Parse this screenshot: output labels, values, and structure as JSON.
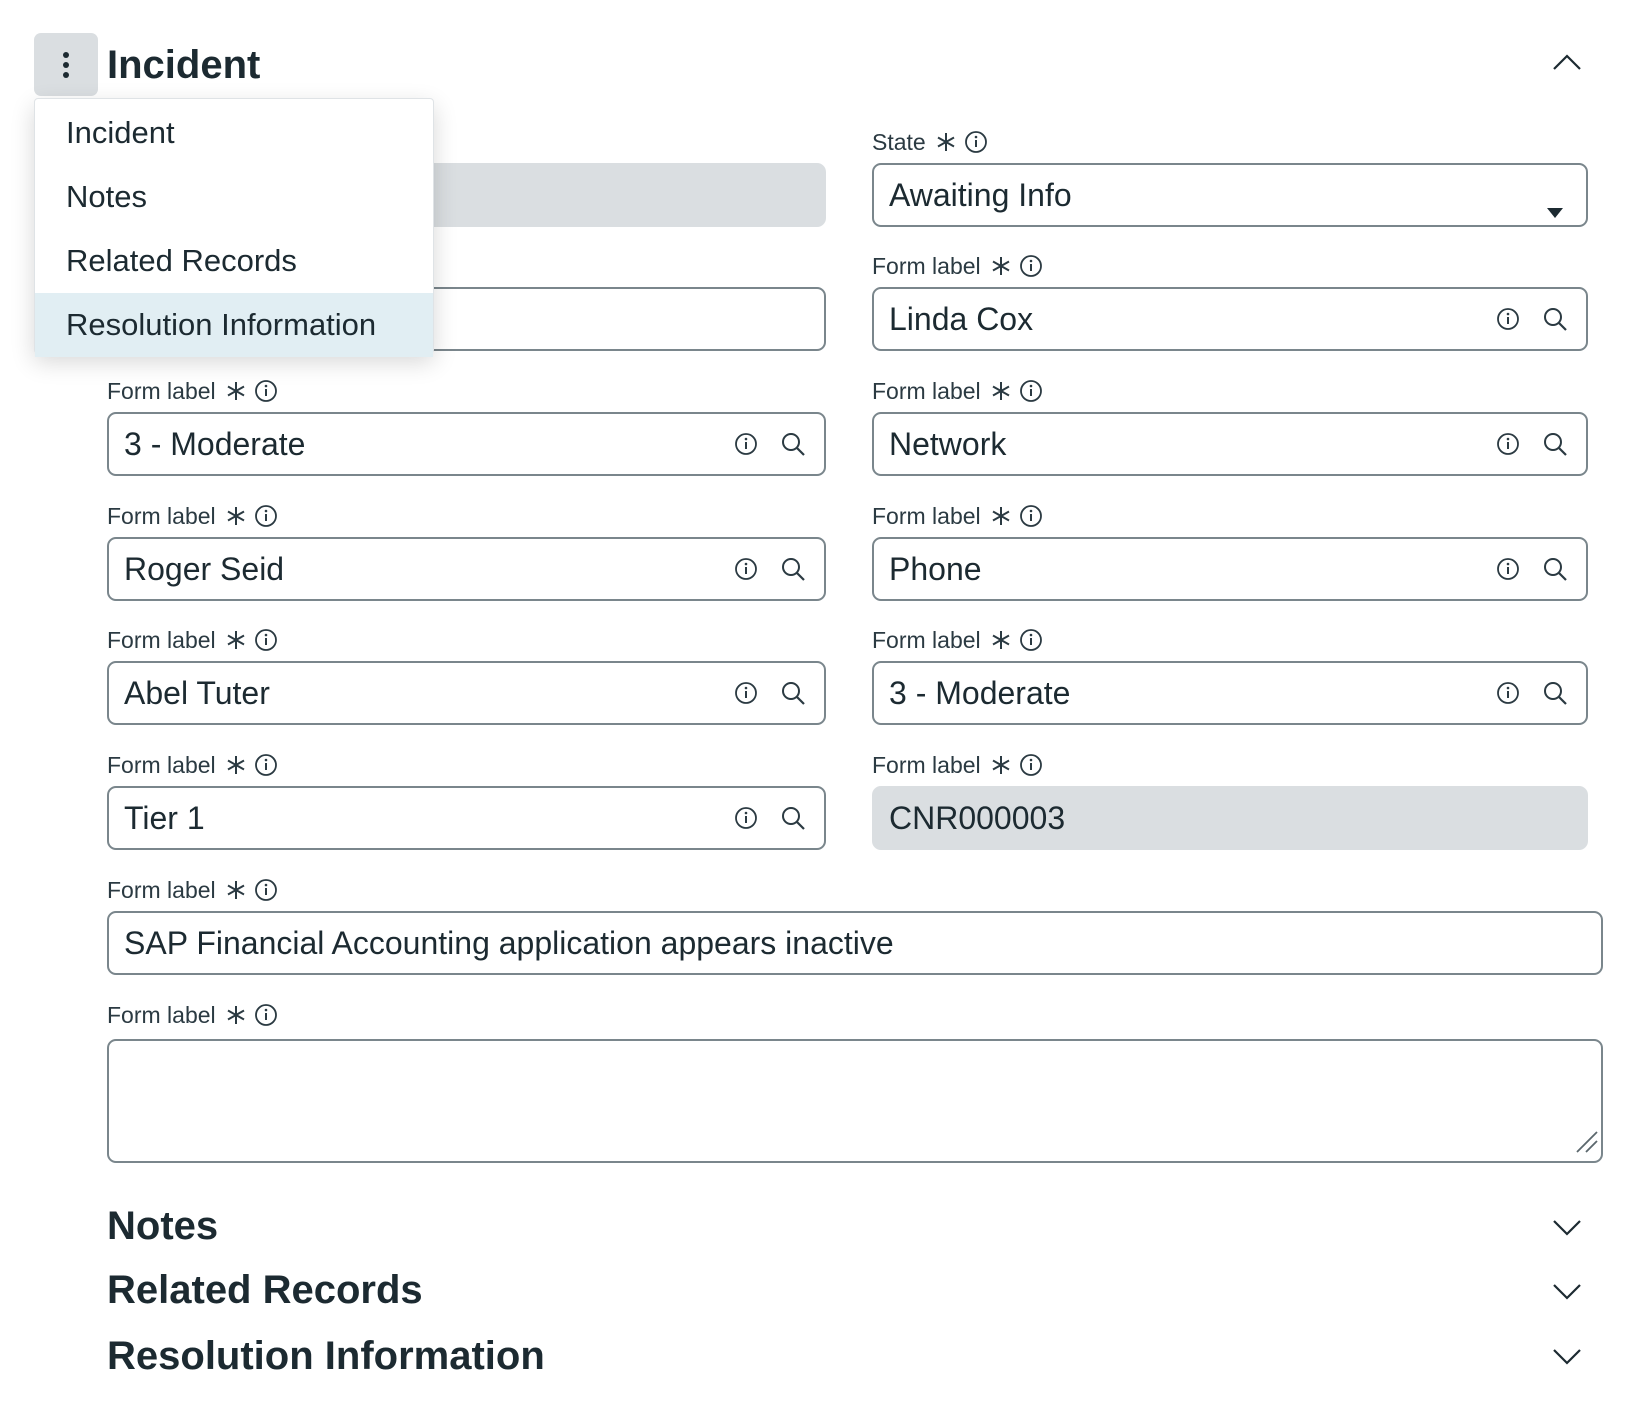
{
  "section": {
    "title": "Incident",
    "menu_icon": "vertical-ellipsis-icon",
    "collapse_icon": "chevron-up-icon"
  },
  "dropdown": {
    "items": [
      {
        "label": "Incident",
        "selected": false
      },
      {
        "label": "Notes",
        "selected": false
      },
      {
        "label": "Related Records",
        "selected": false
      },
      {
        "label": "Resolution Information",
        "selected": true
      }
    ]
  },
  "fields": {
    "state": {
      "label": "State",
      "value": "Awaiting Info"
    },
    "top_right_2": {
      "label": "Form label",
      "value": "Linda Cox"
    },
    "left_3": {
      "label": "Form label",
      "value": "3 - Moderate"
    },
    "right_3": {
      "label": "Form label",
      "value": "Network"
    },
    "left_4": {
      "label": "Form label",
      "value": "Roger Seid"
    },
    "right_4": {
      "label": "Form label",
      "value": "Phone"
    },
    "left_5": {
      "label": "Form label",
      "value": "Abel Tuter"
    },
    "right_5": {
      "label": "Form label",
      "value": "3 - Moderate"
    },
    "left_6": {
      "label": "Form label",
      "value": "Tier 1"
    },
    "right_6": {
      "label": "Form label",
      "value": "CNR000003"
    },
    "short_description": {
      "label": "Form label",
      "value": "SAP Financial Accounting application appears inactive"
    },
    "description": {
      "label": "Form label",
      "value": ""
    }
  },
  "collapsed_sections": [
    {
      "title": "Notes"
    },
    {
      "title": "Related Records"
    },
    {
      "title": "Resolution Information"
    }
  ],
  "colors": {
    "border": "#7a868c",
    "readonly_bg": "#dadee1",
    "selected_item_bg": "#e1eef3",
    "text": "#1c2a31"
  }
}
